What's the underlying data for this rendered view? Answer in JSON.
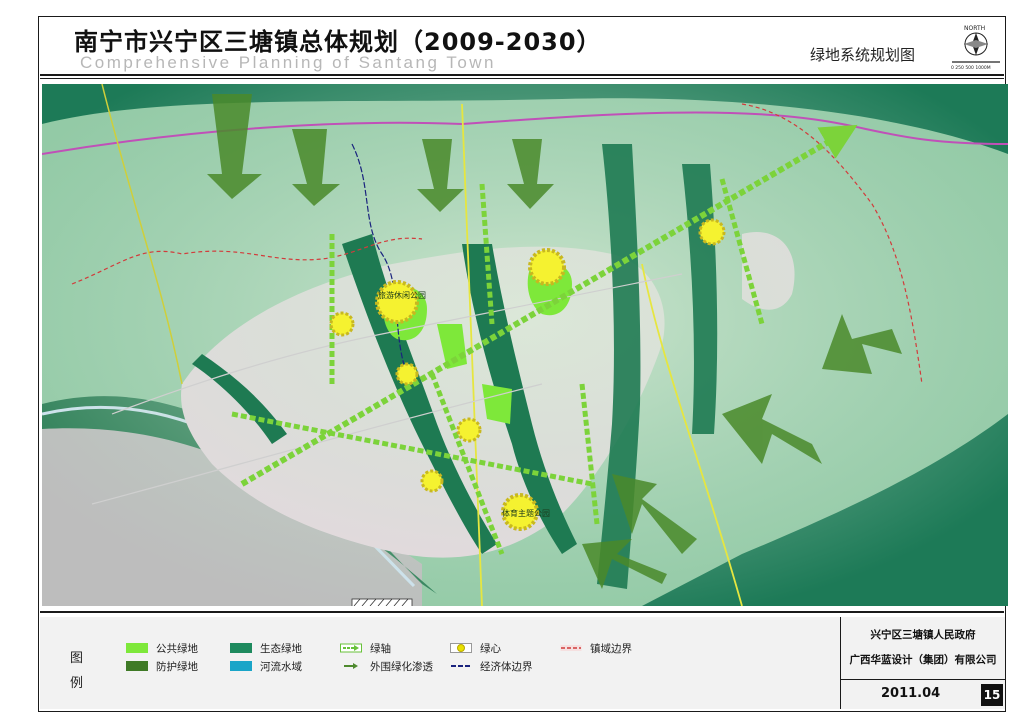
{
  "header": {
    "title_cn": "南宁市兴宁区三塘镇总体规划（2009-2030）",
    "title_en": "Comprehensive Planning of Santang Town",
    "sheet_title": "绿地系统规划图",
    "north_label": "NORTH",
    "scale_label": "0  250  500     1000M"
  },
  "map": {
    "place_labels": [
      "旅游休闲公园",
      "体育主题公园"
    ]
  },
  "legend": {
    "label": "图 例",
    "items": [
      {
        "label": "公共绿地",
        "color": "#7ee83a",
        "kind": "fill"
      },
      {
        "label": "防护绿地",
        "color": "#3f7a26",
        "kind": "fill"
      },
      {
        "label": "生态绿地",
        "color": "#1e8a5e",
        "kind": "fill"
      },
      {
        "label": "河流水域",
        "color": "#1aa5c8",
        "kind": "fill"
      },
      {
        "label": "绿轴",
        "color": "#68c23a",
        "kind": "arrow"
      },
      {
        "label": "外围绿化渗透",
        "color": "#4e8a2e",
        "kind": "arrow-small"
      },
      {
        "label": "绿心",
        "color": "#e8e000",
        "kind": "circle"
      },
      {
        "label": "经济体边界",
        "color": "#1a237e",
        "kind": "line"
      },
      {
        "label": "镇域边界",
        "color": "#d23b3b",
        "kind": "dashline"
      }
    ]
  },
  "footer": {
    "gov_line1": "兴宁区三塘镇人民政府",
    "gov_line2": "广西华蓝设计（集团）有限公司",
    "date": "2011.04",
    "page": "15"
  }
}
